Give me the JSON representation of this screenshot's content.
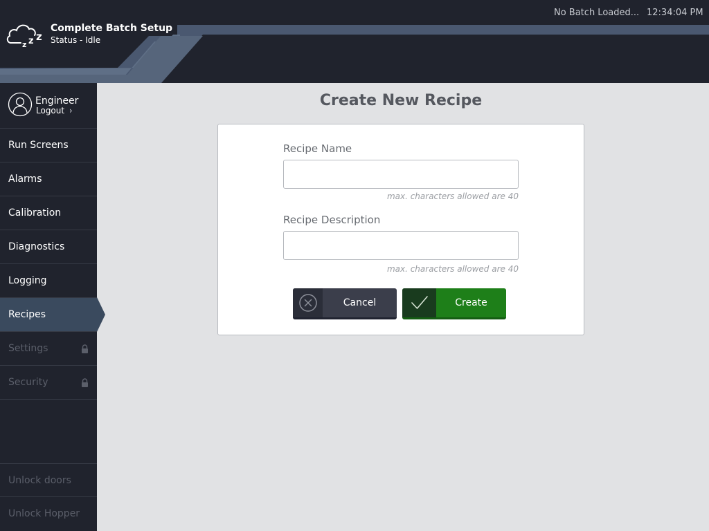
{
  "header": {
    "title": "Complete Batch Setup",
    "status": "Status - Idle",
    "batch_status": "No Batch Loaded...",
    "clock": "12:34:04 PM",
    "icon": "sleeping-cloud-icon"
  },
  "user": {
    "name": "Engineer",
    "logout_label": "Logout",
    "icon": "user-avatar-icon"
  },
  "sidebar": {
    "items": [
      {
        "label": "Run Screens",
        "state": "enabled"
      },
      {
        "label": "Alarms",
        "state": "enabled"
      },
      {
        "label": "Calibration",
        "state": "enabled"
      },
      {
        "label": "Diagnostics",
        "state": "enabled"
      },
      {
        "label": "Logging",
        "state": "enabled"
      },
      {
        "label": "Recipes",
        "state": "active"
      },
      {
        "label": "Settings",
        "state": "locked"
      },
      {
        "label": "Security",
        "state": "locked"
      }
    ],
    "bottom_items": [
      {
        "label": "Unlock doors",
        "state": "disabled"
      },
      {
        "label": "Unlock Hopper",
        "state": "disabled"
      }
    ]
  },
  "main": {
    "title": "Create New Recipe",
    "fields": [
      {
        "label": "Recipe Name",
        "value": "",
        "hint": "max. characters allowed are 40"
      },
      {
        "label": "Recipe Description",
        "value": "",
        "hint": "max. characters allowed are 40"
      }
    ],
    "buttons": {
      "cancel_label": "Cancel",
      "create_label": "Create"
    }
  },
  "colors": {
    "header_bg": "#20232d",
    "sidebar_bg": "#20232d",
    "active_nav": "#3a4a5e",
    "content_bg": "#e1e2e4",
    "create_green": "#1e7f19",
    "cancel_dark": "#3b3e4b"
  }
}
